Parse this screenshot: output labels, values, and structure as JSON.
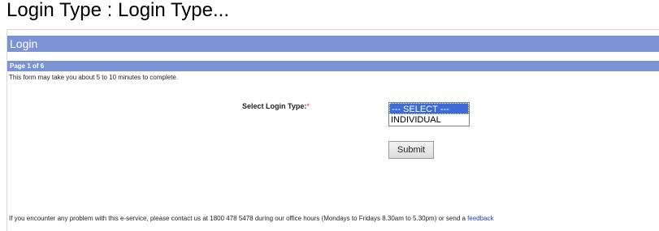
{
  "header": {
    "partial_title": "Login Type : Login Type..."
  },
  "form": {
    "title": "Login",
    "page_indicator": "Page 1 of 6",
    "hint": "This form may take you about 5 to 10 minutes to complete.",
    "login_type_label": "Select Login Type:",
    "required_mark": "*",
    "login_type_options": [
      "--- SELECT ---",
      "INDIVIDUAL"
    ],
    "selected_option": "--- SELECT ---",
    "submit_label": "Submit"
  },
  "footer": {
    "text": "If you encounter any problem with this e-service, please contact us at 1800 478 5478 during our office hours (Mondays to Fridays 8.30am to 5.30pm) or send a ",
    "feedback_link": "feedback"
  },
  "colors": {
    "title_bar": "#7b93d4",
    "selected_option_bg": "#3c6bd8",
    "link": "#2040c0",
    "required": "#d03030"
  }
}
